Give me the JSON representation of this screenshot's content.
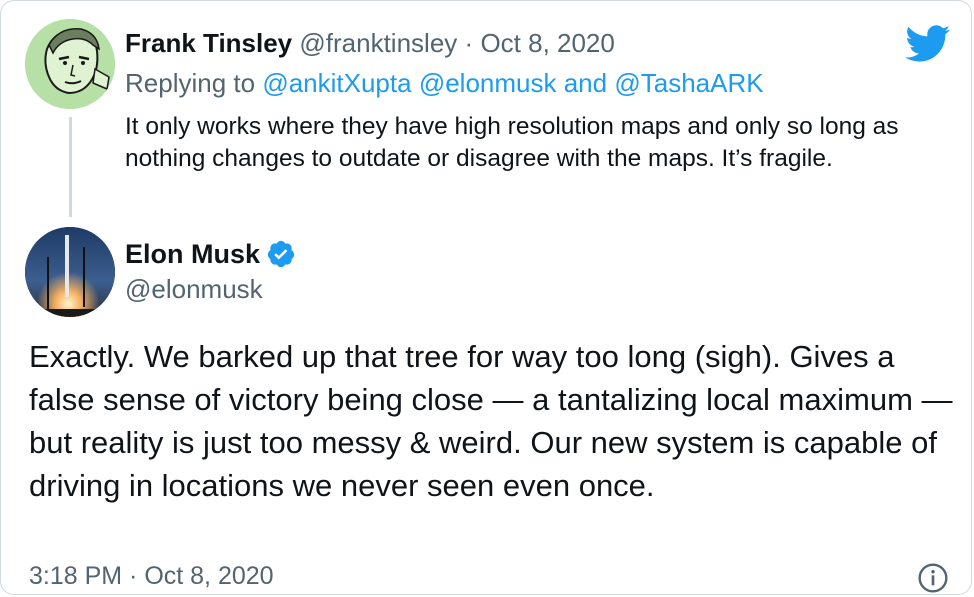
{
  "brand": {
    "icon": "twitter-bird-icon",
    "color": "#1d9bf0"
  },
  "reply_tweet": {
    "avatar_icon": "frank-tinsley-avatar",
    "name": "Frank Tinsley",
    "handle": "@franktinsley",
    "separator": "·",
    "date": "Oct 8, 2020",
    "replying_label": "Replying to",
    "mentions": [
      "@ankitXupta",
      "@elonmusk",
      "@TashaARK"
    ],
    "mention_joiner": "and",
    "text": "It only works where they have high resolution maps and only so long as nothing changes to outdate or disagree with the maps. It’s fragile."
  },
  "main_tweet": {
    "avatar_icon": "elon-musk-avatar",
    "name": "Elon Musk",
    "verified_icon": "verified-badge-icon",
    "handle": "@elonmusk",
    "text": "Exactly. We barked up that tree for way too long (sigh). Gives a false sense of victory being close — a tantalizing local maximum — but reality is just too messy & weird. Our new system is capable of driving in locations we never seen even once.",
    "timestamp": "3:18 PM · Oct 8, 2020",
    "info_icon": "info-icon"
  },
  "colors": {
    "text": "#0f1419",
    "muted": "#536471",
    "link": "#1d9bf0",
    "border": "#cfd9de"
  }
}
